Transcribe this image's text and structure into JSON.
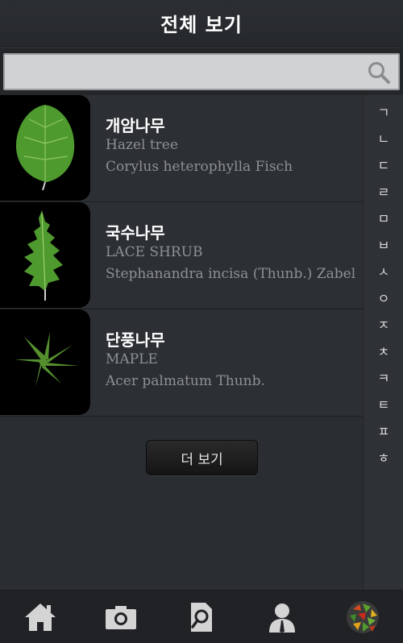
{
  "header": {
    "title": "전체 보기"
  },
  "search": {
    "value": "",
    "placeholder": ""
  },
  "list": {
    "items": [
      {
        "name_ko": "개암나무",
        "name_en": "Hazel tree",
        "name_sci": "Corylus heterophylla Fisch"
      },
      {
        "name_ko": "국수나무",
        "name_en": "LACE SHRUB",
        "name_sci": "Stephanandra incisa (Thunb.) Zabel"
      },
      {
        "name_ko": "단풍나무",
        "name_en": "MAPLE",
        "name_sci": "Acer palmatum Thunb."
      }
    ]
  },
  "more": {
    "label": "더 보기"
  },
  "index": {
    "letters": [
      "ㄱ",
      "ㄴ",
      "ㄷ",
      "ㄹ",
      "ㅁ",
      "ㅂ",
      "ㅅ",
      "ㅇ",
      "ㅈ",
      "ㅊ",
      "ㅋ",
      "ㅌ",
      "ㅍ",
      "ㅎ"
    ]
  },
  "footer": {
    "tabs": [
      "home-icon",
      "camera-icon",
      "document-search-icon",
      "person-icon",
      "leaf-collage-icon"
    ]
  },
  "colors": {
    "background": "#2a2d31",
    "secondary_text": "#8d9094",
    "leaf_green": "#4f9a2f"
  }
}
